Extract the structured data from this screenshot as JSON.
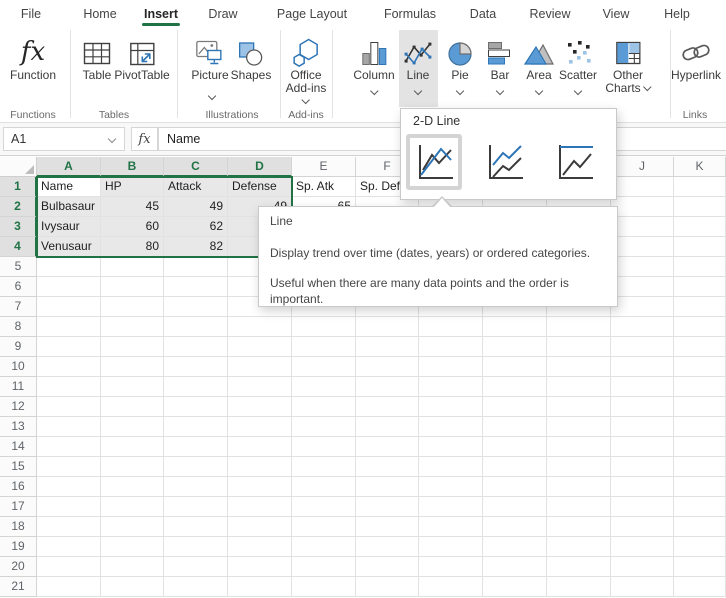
{
  "menubar": {
    "tabs": [
      {
        "label": "File"
      },
      {
        "label": "Home"
      },
      {
        "label": "Insert"
      },
      {
        "label": "Draw"
      },
      {
        "label": "Page Layout"
      },
      {
        "label": "Formulas"
      },
      {
        "label": "Data"
      },
      {
        "label": "Review"
      },
      {
        "label": "View"
      },
      {
        "label": "Help"
      }
    ],
    "active_tab": "Insert"
  },
  "ribbon": {
    "buttons": {
      "function": {
        "label": "Function"
      },
      "table": {
        "label": "Table"
      },
      "pivottable": {
        "label": "PivotTable"
      },
      "picture": {
        "label": "Picture"
      },
      "shapes": {
        "label": "Shapes"
      },
      "office_addins": {
        "label_line1": "Office",
        "label_line2": "Add-ins"
      },
      "column": {
        "label": "Column"
      },
      "line": {
        "label": "Line",
        "state": "open"
      },
      "pie": {
        "label": "Pie"
      },
      "bar": {
        "label": "Bar"
      },
      "area": {
        "label": "Area"
      },
      "scatter": {
        "label": "Scatter"
      },
      "other_charts": {
        "label_line1": "Other",
        "label_line2": "Charts"
      },
      "hyperlink": {
        "label": "Hyperlink"
      }
    },
    "group_labels": {
      "functions": "Functions",
      "tables": "Tables",
      "illustrations": "Illustrations",
      "addins": "Add-ins",
      "links": "Links"
    }
  },
  "formula_bar": {
    "name_box_value": "A1",
    "formula_value": "Name"
  },
  "grid": {
    "column_letters": [
      "A",
      "B",
      "C",
      "D",
      "E",
      "F",
      "G",
      "H",
      "I",
      "J",
      "K"
    ],
    "row_count": 21,
    "selected_columns": [
      "A",
      "B",
      "C",
      "D"
    ],
    "selected_rows": [
      1,
      2,
      3,
      4
    ],
    "active_cell": "A1",
    "selection_range": "A1:D4",
    "cells": [
      {
        "ref": "A1",
        "value": "Name",
        "align": "left"
      },
      {
        "ref": "B1",
        "value": "HP",
        "align": "left"
      },
      {
        "ref": "C1",
        "value": "Attack",
        "align": "left"
      },
      {
        "ref": "D1",
        "value": "Defense",
        "align": "left"
      },
      {
        "ref": "E1",
        "value": "Sp. Atk",
        "align": "left"
      },
      {
        "ref": "F1",
        "value": "Sp. Def",
        "align": "left"
      },
      {
        "ref": "A2",
        "value": "Bulbasaur",
        "align": "left"
      },
      {
        "ref": "B2",
        "value": "45",
        "align": "right"
      },
      {
        "ref": "C2",
        "value": "49",
        "align": "right"
      },
      {
        "ref": "D2",
        "value": "49",
        "align": "right"
      },
      {
        "ref": "E2",
        "value": "65",
        "align": "right"
      },
      {
        "ref": "A3",
        "value": "Ivysaur",
        "align": "left"
      },
      {
        "ref": "B3",
        "value": "60",
        "align": "right"
      },
      {
        "ref": "C3",
        "value": "62",
        "align": "right"
      },
      {
        "ref": "A4",
        "value": "Venusaur",
        "align": "left"
      },
      {
        "ref": "B4",
        "value": "80",
        "align": "right"
      },
      {
        "ref": "C4",
        "value": "82",
        "align": "right"
      }
    ]
  },
  "chart_dropdown": {
    "title": "2-D Line",
    "options": [
      {
        "name": "line",
        "selected": true
      },
      {
        "name": "stacked-line",
        "selected": false
      },
      {
        "name": "100-percent-stacked-line",
        "selected": false
      }
    ]
  },
  "tooltip": {
    "title": "Line",
    "paragraph1": "Display trend over time (dates, years) or ordered categories.",
    "paragraph2": "Useful when there are many data points and the order is important."
  },
  "colors": {
    "accent_green": "#217346",
    "icon_blue": "#2E75B6",
    "icon_blue_fill": "#5B9BD5",
    "icon_blue_light": "#9DC3E6",
    "selection_fill": "#e8e8e8",
    "open_button_bg": "#e3e3e3"
  }
}
